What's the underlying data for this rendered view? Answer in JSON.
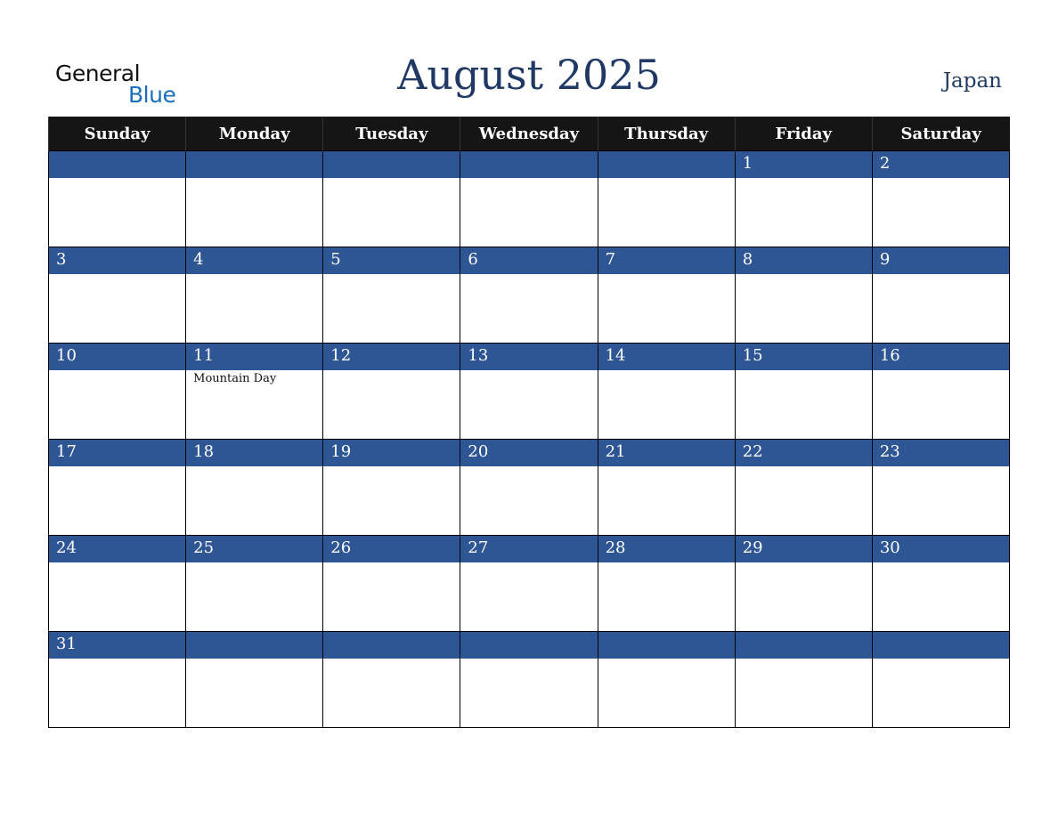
{
  "logo": {
    "word1": "General",
    "word2": "Blue"
  },
  "header": {
    "title": "August 2025",
    "country": "Japan"
  },
  "colors": {
    "title": "#1f3864",
    "header_bg": "#151515",
    "date_band": "#2e5594",
    "logo_blue": "#1a6fba"
  },
  "weekdays": [
    "Sunday",
    "Monday",
    "Tuesday",
    "Wednesday",
    "Thursday",
    "Friday",
    "Saturday"
  ],
  "weeks": [
    [
      {
        "d": ""
      },
      {
        "d": ""
      },
      {
        "d": ""
      },
      {
        "d": ""
      },
      {
        "d": ""
      },
      {
        "d": "1"
      },
      {
        "d": "2"
      }
    ],
    [
      {
        "d": "3"
      },
      {
        "d": "4"
      },
      {
        "d": "5"
      },
      {
        "d": "6"
      },
      {
        "d": "7"
      },
      {
        "d": "8"
      },
      {
        "d": "9"
      }
    ],
    [
      {
        "d": "10"
      },
      {
        "d": "11",
        "e": "Mountain Day"
      },
      {
        "d": "12"
      },
      {
        "d": "13"
      },
      {
        "d": "14"
      },
      {
        "d": "15"
      },
      {
        "d": "16"
      }
    ],
    [
      {
        "d": "17"
      },
      {
        "d": "18"
      },
      {
        "d": "19"
      },
      {
        "d": "20"
      },
      {
        "d": "21"
      },
      {
        "d": "22"
      },
      {
        "d": "23"
      }
    ],
    [
      {
        "d": "24"
      },
      {
        "d": "25"
      },
      {
        "d": "26"
      },
      {
        "d": "27"
      },
      {
        "d": "28"
      },
      {
        "d": "29"
      },
      {
        "d": "30"
      }
    ],
    [
      {
        "d": "31"
      },
      {
        "d": ""
      },
      {
        "d": ""
      },
      {
        "d": ""
      },
      {
        "d": ""
      },
      {
        "d": ""
      },
      {
        "d": ""
      }
    ]
  ]
}
